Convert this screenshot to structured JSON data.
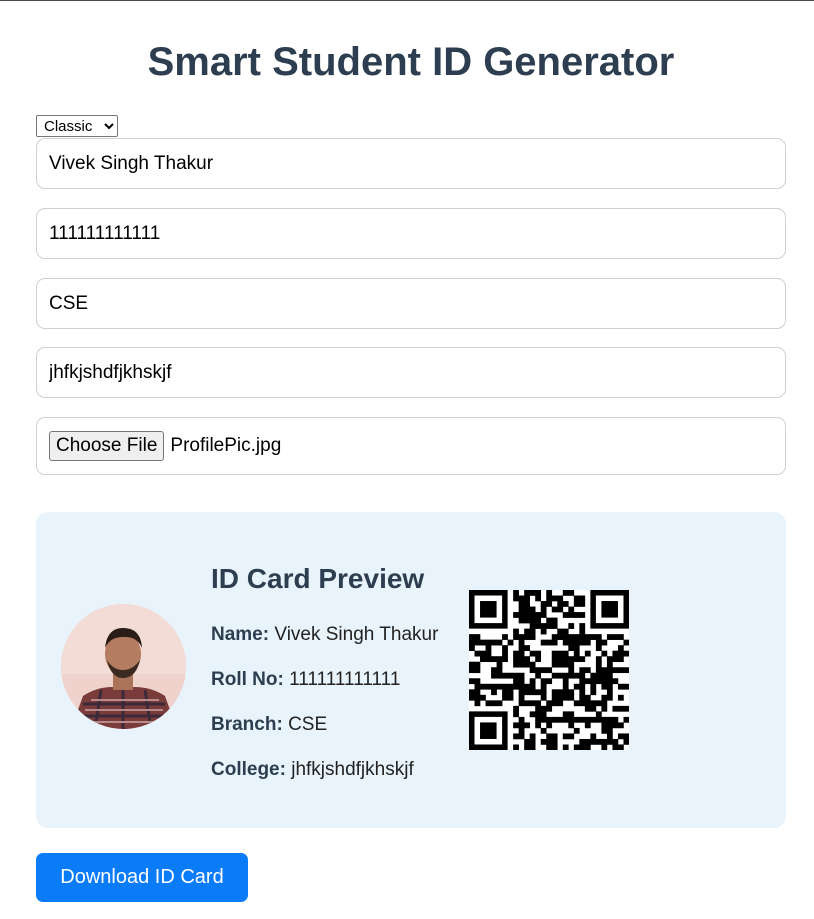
{
  "header": {
    "title": "Smart Student ID Generator"
  },
  "form": {
    "template": {
      "selected": "Classic",
      "options": [
        "Classic"
      ]
    },
    "name_value": "Vivek Singh Thakur",
    "roll_value": "111111111111",
    "branch_value": "CSE",
    "college_value": "jhfkjshdfjkhskjf",
    "file_button_label": "Choose File",
    "file_name": "ProfilePic.jpg"
  },
  "preview": {
    "heading": "ID Card Preview",
    "name_label": "Name:",
    "name": "Vivek Singh Thakur",
    "roll_label": "Roll No:",
    "roll": "111111111111",
    "branch_label": "Branch:",
    "branch": "CSE",
    "college_label": "College:",
    "college": "jhfkjshdfjkhskjf",
    "photo_icon": "student-photo",
    "qr_icon": "qr-code"
  },
  "actions": {
    "download_label": "Download ID Card"
  },
  "colors": {
    "accent": "#0a7cf7",
    "title": "#2c3e50",
    "card_background": "#e8f3fb"
  }
}
